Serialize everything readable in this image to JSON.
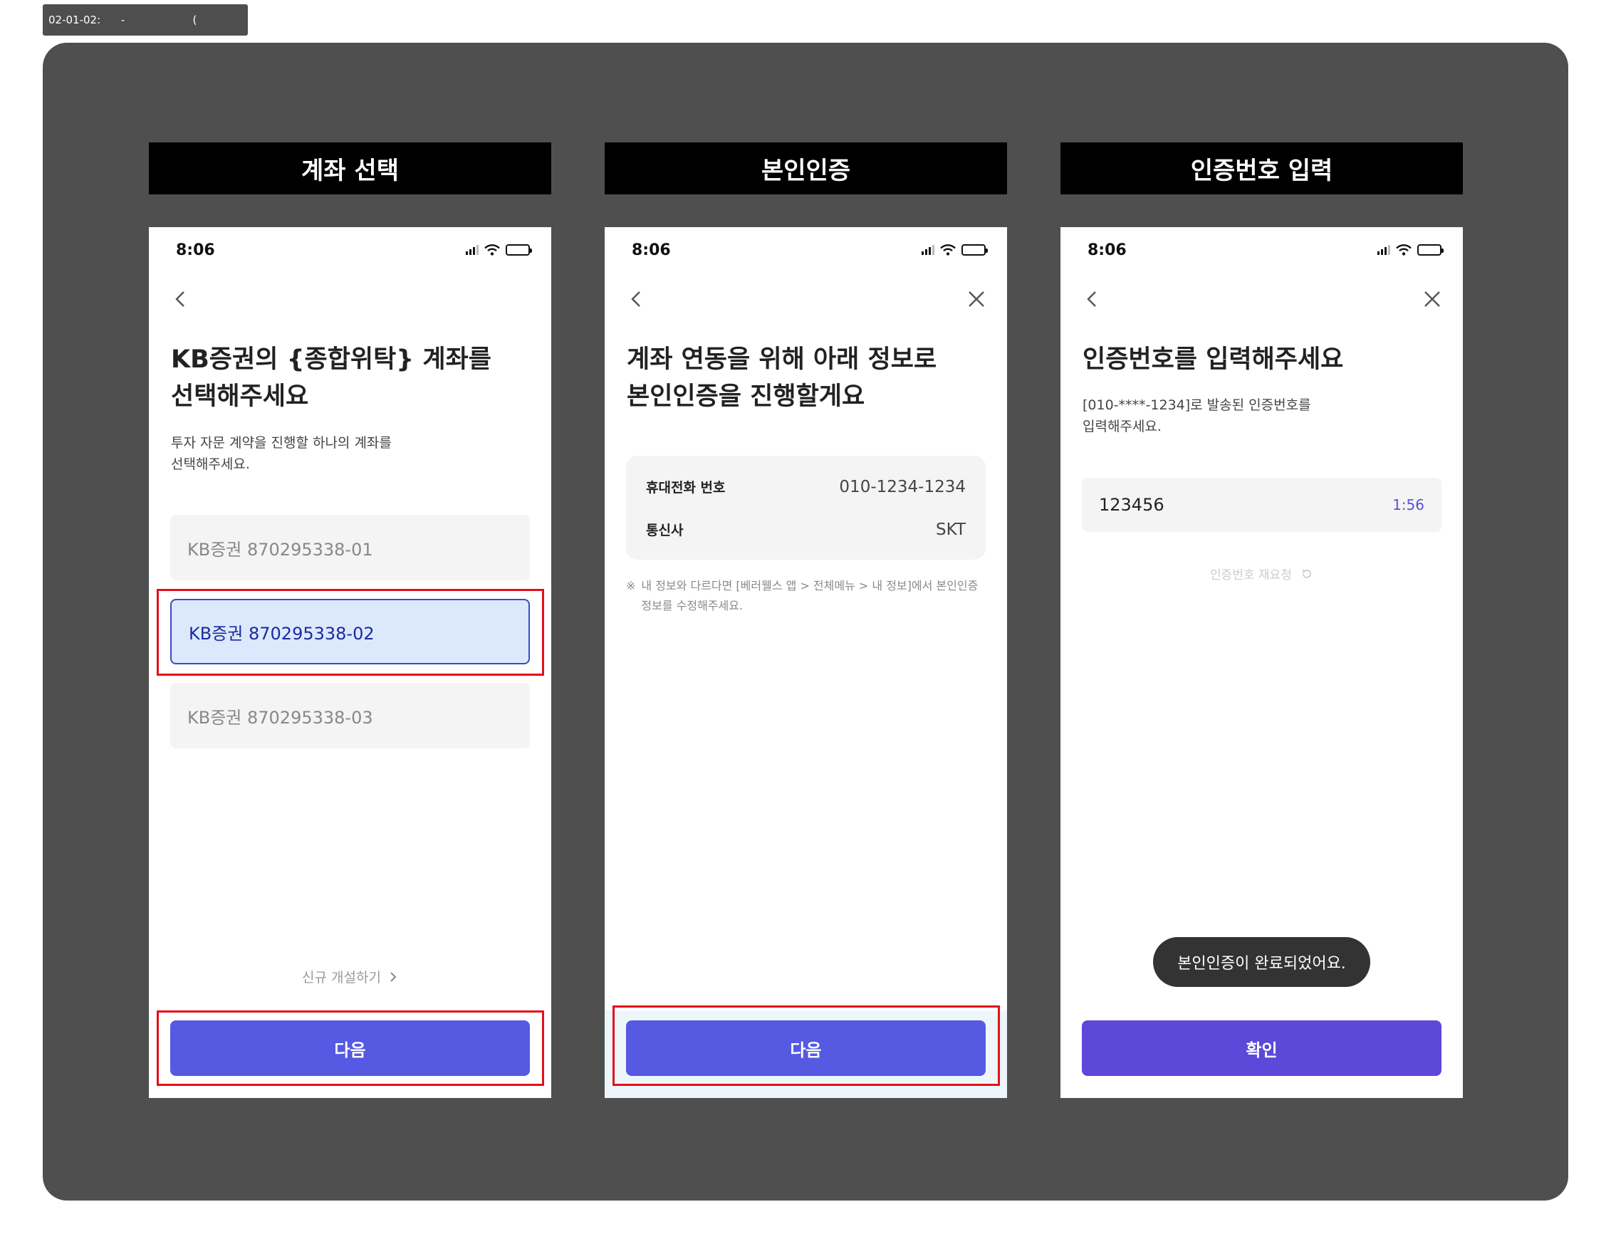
{
  "frame_tag": "02-01-02:      -                    (",
  "phases": [
    {
      "header": "계좌 선택",
      "status_time": "8:06",
      "headline_line1": "KB증권의 {종합위탁} 계좌를",
      "headline_line2": "선택해주세요",
      "sub_line1": "투자 자문 계약을 진행할 하나의 계좌를",
      "sub_line2": "선택해주세요.",
      "accounts": [
        {
          "label": "KB증권  870295338-01",
          "selected": false
        },
        {
          "label": "KB증권  870295338-02",
          "selected": true
        },
        {
          "label": "KB증권  870295338-03",
          "selected": false
        }
      ],
      "new_account_link": "신규 개설하기",
      "button_label": "다음"
    },
    {
      "header": "본인인증",
      "status_time": "8:06",
      "headline_line1": "계좌 연동을 위해 아래 정보로",
      "headline_line2": "본인인증을 진행할게요",
      "info": [
        {
          "label": "휴대전화 번호",
          "value": "010-1234-1234"
        },
        {
          "label": "통신사",
          "value": "SKT"
        }
      ],
      "note_mark": "※",
      "note_line1": "내 정보와 다르다면 [베러웰스 앱 > 전체메뉴 > 내 정보]에서 본인인증",
      "note_line2": "정보를 수정해주세요.",
      "button_label": "다음"
    },
    {
      "header": "인증번호 입력",
      "status_time": "8:06",
      "headline_line1": "인증번호를 입력해주세요",
      "sub_line1": "[010-****-1234]로 발송된 인증번호를",
      "sub_line2": "입력해주세요.",
      "code_value": "123456",
      "timer": "1:56",
      "resend_label": "인증번호 재요청",
      "toast": "본인인증이 완료되었어요.",
      "button_label": "확인"
    }
  ],
  "colors": {
    "primary_button": "#5659e1",
    "confirm_button": "#5c48d9",
    "highlight_red": "#e3101a",
    "selected_bg": "#dce9fd",
    "selected_border": "#3a4ac7",
    "board_bg": "#4f4f4f"
  },
  "icons": [
    "back-chevron-icon",
    "close-icon",
    "chevron-right-icon",
    "refresh-icon",
    "signal-icon",
    "wifi-icon",
    "battery-icon"
  ]
}
